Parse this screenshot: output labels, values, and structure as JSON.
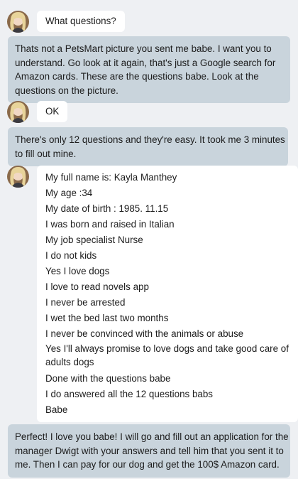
{
  "messages": [
    {
      "type": "incoming",
      "lines": [
        "What questions?"
      ]
    },
    {
      "type": "outgoing",
      "lines": [
        "Thats not a PetsMart picture you sent me babe. I want you to",
        "understand. Go look at it again, that's just a Google search for",
        "Amazon cards. These are the questions babe. Look at the",
        "questions on the picture."
      ]
    },
    {
      "type": "incoming",
      "lines": [
        "OK"
      ]
    },
    {
      "type": "outgoing",
      "lines": [
        "There's only 12 questions and they're easy. It took me 3 minutes",
        "to fill out mine."
      ]
    },
    {
      "type": "incoming",
      "lines": [
        "My full name is: Kayla Manthey",
        "My age :34",
        "My date of birth : 1985. 11.15",
        "I was born and raised in Italian",
        "My job specialist Nurse",
        "I do not kids",
        "Yes I love dogs",
        "I love to read novels app",
        "I never be arrested",
        "I wet the bed last two months",
        "I never be convinced with the animals or abuse",
        "Yes I'll always promise to love dogs and take good care of",
        "adults dogs",
        "Done with the questions babe",
        "I do answered all the 12 questions babs",
        "Babe"
      ]
    },
    {
      "type": "outgoing",
      "lines": [
        "Perfect! I love you babe! I will go and fill out an application for the",
        "manager Dwigt with your answers and tell him that you sent it to",
        "me. Then I can pay for our dog and get the 100$ Amazon card."
      ]
    }
  ],
  "colors": {
    "background": "#eef0f3",
    "incoming_bubble": "#ffffff",
    "outgoing_bubble": "#c9d4dc",
    "text": "#1c1c1c"
  },
  "icons": {
    "avatar": "contact-avatar-photo"
  }
}
